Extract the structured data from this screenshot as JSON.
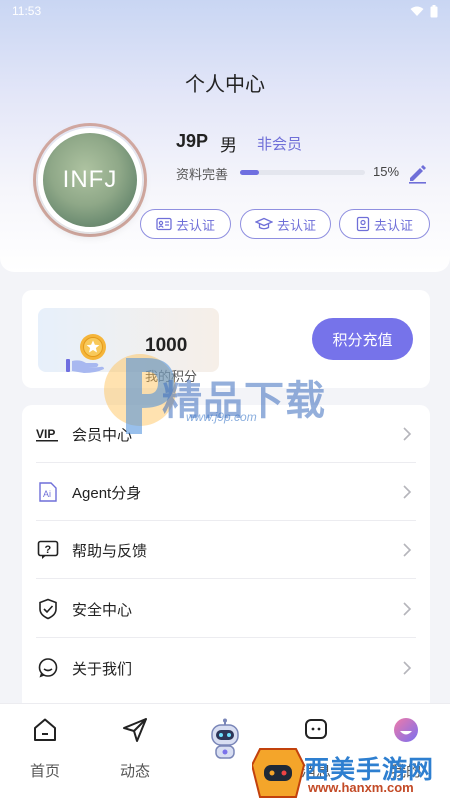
{
  "status_bar": {
    "time": "11:53"
  },
  "header": {
    "title": "个人中心",
    "avatar_text": "INFJ",
    "user_name": "J9P",
    "gender": "男",
    "member_status": "非会员",
    "profile_completion_label": "资料完善",
    "profile_completion_value": "15%",
    "profile_completion_fraction": 0.15,
    "certifications": [
      {
        "label": "去认证",
        "icon": "id-card-icon"
      },
      {
        "label": "去认证",
        "icon": "graduation-cap-icon"
      },
      {
        "label": "去认证",
        "icon": "badge-icon"
      }
    ]
  },
  "points": {
    "value": "1000",
    "label": "我的积分",
    "recharge_label": "积分充值"
  },
  "menu": {
    "items": [
      {
        "label": "会员中心",
        "icon": "vip-icon"
      },
      {
        "label": "Agent分身",
        "icon": "agent-icon"
      },
      {
        "label": "帮助与反馈",
        "icon": "help-icon"
      },
      {
        "label": "安全中心",
        "icon": "shield-icon"
      },
      {
        "label": "关于我们",
        "icon": "chat-bubble-icon"
      }
    ]
  },
  "tabs": [
    {
      "label": "首页",
      "icon": "home-icon"
    },
    {
      "label": "动态",
      "icon": "send-icon"
    },
    {
      "label": "",
      "icon": "robot-icon"
    },
    {
      "label": "消息",
      "icon": "message-icon"
    },
    {
      "label": "我的",
      "icon": "profile-icon"
    }
  ],
  "watermarks": {
    "primary_text": "精品下载",
    "primary_url": "www.j9p.com",
    "secondary_text": "西美手游网",
    "secondary_url": "www.hanxm.com"
  },
  "colors": {
    "accent": "#7673ea",
    "accent_text": "#6f6fd8"
  }
}
